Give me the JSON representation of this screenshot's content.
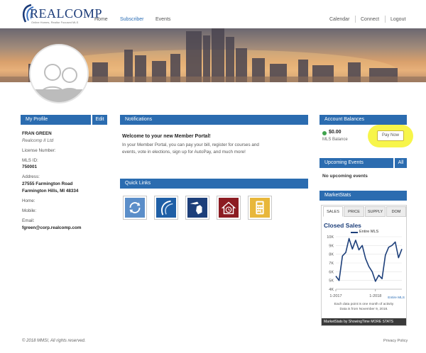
{
  "header": {
    "logo_text": "REALCOMP",
    "logo_tagline": "Online Homes, Realtor Focused MLS",
    "nav_left": [
      "Home",
      "Subscriber",
      "Events"
    ],
    "nav_right": [
      "Calendar",
      "Connect",
      "Logout"
    ],
    "active_nav": "Subscriber",
    "brand_color": "#1a3a78"
  },
  "profile": {
    "heading": "My Profile",
    "edit_label": "Edit",
    "name": "FRAN GREEN",
    "company": "Realcomp II Ltd",
    "license_label": "License Number:",
    "mls_id_label": "MLS ID:",
    "mls_id": "750001",
    "address_label": "Address:",
    "street": "27555 Farmington Road",
    "city": "Farmington Hills, MI 48334",
    "home_label": "Home:",
    "mobile_label": "Mobile:",
    "email_label": "Email:",
    "email": "fgreen@corp.realcomp.com"
  },
  "notifications": {
    "heading": "Notifications",
    "title": "Welcome to your new Member Portal!",
    "body": "In your Member Portal, you can pay your bill, register for courses and events, vote in elections, sign up for AutoPay, and much more!"
  },
  "quick_links": {
    "heading": "Quick Links",
    "icons": [
      "refresh-arrows-icon",
      "swoosh-icon",
      "michigan-map-icon",
      "house-clock-icon",
      "calculator-icon"
    ]
  },
  "balances": {
    "heading": "Account Balances",
    "amount": "$0.00",
    "label": "MLS Balance",
    "pay_label": "Pay Now",
    "status_color": "#3fa34d",
    "highlight_color": "#f7f54a"
  },
  "events": {
    "heading": "Upcoming Events",
    "all_label": "All",
    "empty_text": "No upcoming events"
  },
  "marketstats": {
    "heading": "MarketStats",
    "tabs": [
      "SALES",
      "PRICE",
      "SUPPLY",
      "DOM"
    ],
    "active_tab": "SALES",
    "title": "Closed Sales",
    "legend": "Entire MLS",
    "footer_series": "Entire MLS",
    "note_line1": "Each data point is one month of activity",
    "note_line2": "Data is from November 9, 2018.",
    "bar_text": "MarketStats by ShowingTime MORE STATS"
  },
  "chart_data": {
    "type": "line",
    "title": "Closed Sales",
    "series": [
      {
        "name": "Entire MLS",
        "values": [
          5.5,
          5.0,
          7.8,
          8.2,
          9.8,
          8.6,
          9.6,
          8.5,
          9.0,
          7.5,
          6.6,
          6.0,
          4.9,
          5.6,
          5.2,
          7.9,
          8.8,
          9.0,
          9.4,
          7.6,
          8.6
        ]
      }
    ],
    "x_tick_labels": [
      "1-2017",
      "1-2018"
    ],
    "y_tick_labels": [
      "4K",
      "5K",
      "6K",
      "7K",
      "8K",
      "9K",
      "10K"
    ],
    "ylim": [
      4,
      10
    ],
    "y_unit": "thousands",
    "grid": true,
    "line_color": "#1d3f7a"
  },
  "footer": {
    "copyright": "© 2018 MMSI, All rights reserved.",
    "privacy": "Privacy Policy"
  }
}
